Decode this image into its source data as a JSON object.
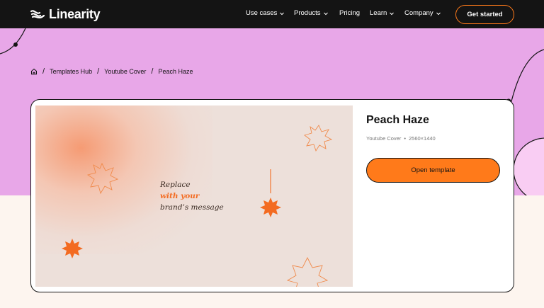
{
  "header": {
    "logo_text": "Linearity",
    "nav": [
      {
        "label": "Use cases",
        "has_dropdown": true
      },
      {
        "label": "Products",
        "has_dropdown": true
      },
      {
        "label": "Pricing",
        "has_dropdown": false
      },
      {
        "label": "Learn",
        "has_dropdown": true
      },
      {
        "label": "Company",
        "has_dropdown": true
      }
    ],
    "cta_label": "Get started"
  },
  "breadcrumb": {
    "home_icon": "home-icon",
    "items": [
      "Templates Hub",
      "Youtube Cover",
      "Peach Haze"
    ],
    "separator": "/"
  },
  "template": {
    "title": "Peach Haze",
    "category": "Youtube Cover",
    "meta_separator": "•",
    "dimensions": "2560×1440",
    "open_button": "Open template",
    "preview": {
      "line1": "Replace",
      "line2": "with your",
      "line3": "brand’s message"
    }
  },
  "colors": {
    "nav_bg": "#141414",
    "hero_bg": "#e8a7e8",
    "accent": "#ff7a1a",
    "page_bg": "#fdf5ef",
    "preview_bg": "#ede0da"
  }
}
